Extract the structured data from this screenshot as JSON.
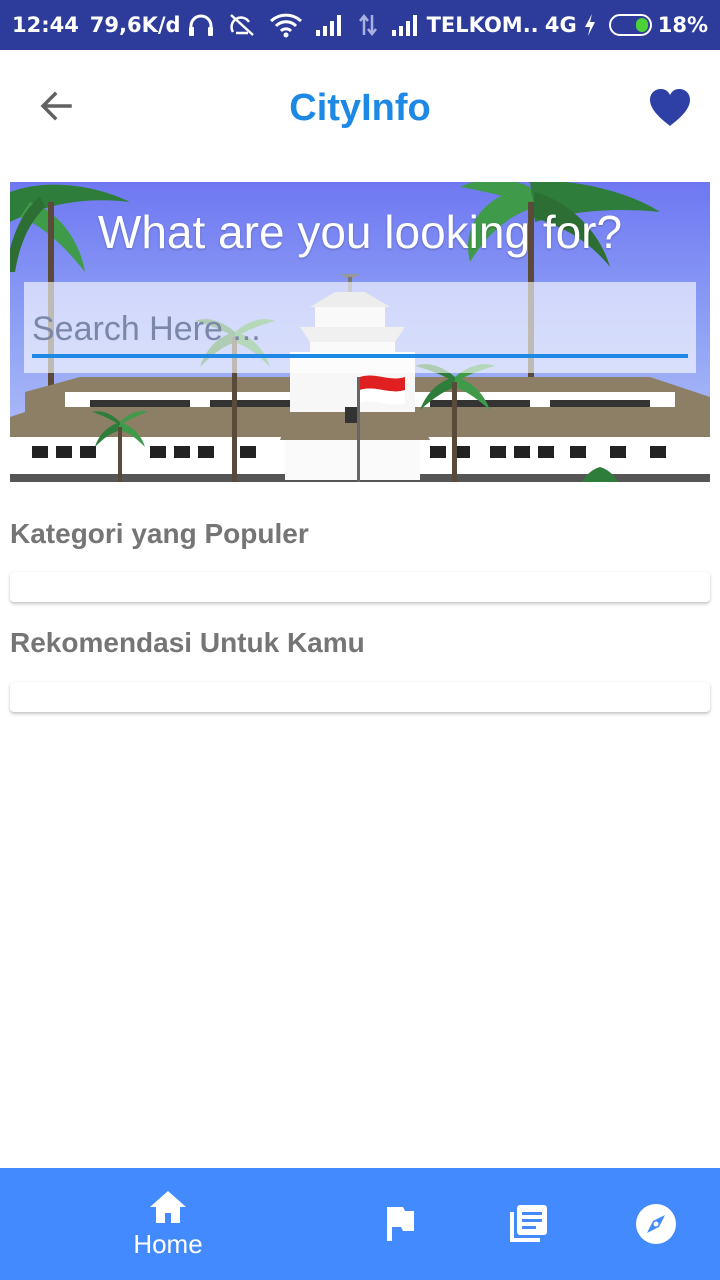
{
  "status_bar": {
    "time": "12:44",
    "network_speed": "79,6K/d",
    "carrier": "TELKOM..",
    "network_type": "4G",
    "battery": "18%",
    "battery_color": "#4cd137",
    "icons": [
      "headphones-icon",
      "vibrate-off-icon",
      "wifi-icon",
      "signal-icon",
      "data-transfer-icon",
      "signal-icon",
      "charging-icon",
      "battery-icon"
    ]
  },
  "app_bar": {
    "title": "CityInfo",
    "back_icon": "arrow-left-icon",
    "favorite_icon": "heart-icon",
    "title_color": "#1e88e5",
    "favorite_color": "#2e3fa6"
  },
  "banner": {
    "heading": "What are you looking for?",
    "search": {
      "placeholder": "Search Here ...",
      "value": ""
    }
  },
  "sections": [
    {
      "title": "Kategori yang Populer"
    },
    {
      "title": "Rekomendasi Untuk Kamu"
    }
  ],
  "bottom_nav": {
    "background": "#448aff",
    "items": [
      {
        "icon": "home-icon",
        "label": "Home",
        "active": true
      },
      {
        "icon": "flag-icon",
        "label": ""
      },
      {
        "icon": "list-icon",
        "label": ""
      },
      {
        "icon": "compass-icon",
        "label": ""
      }
    ]
  }
}
